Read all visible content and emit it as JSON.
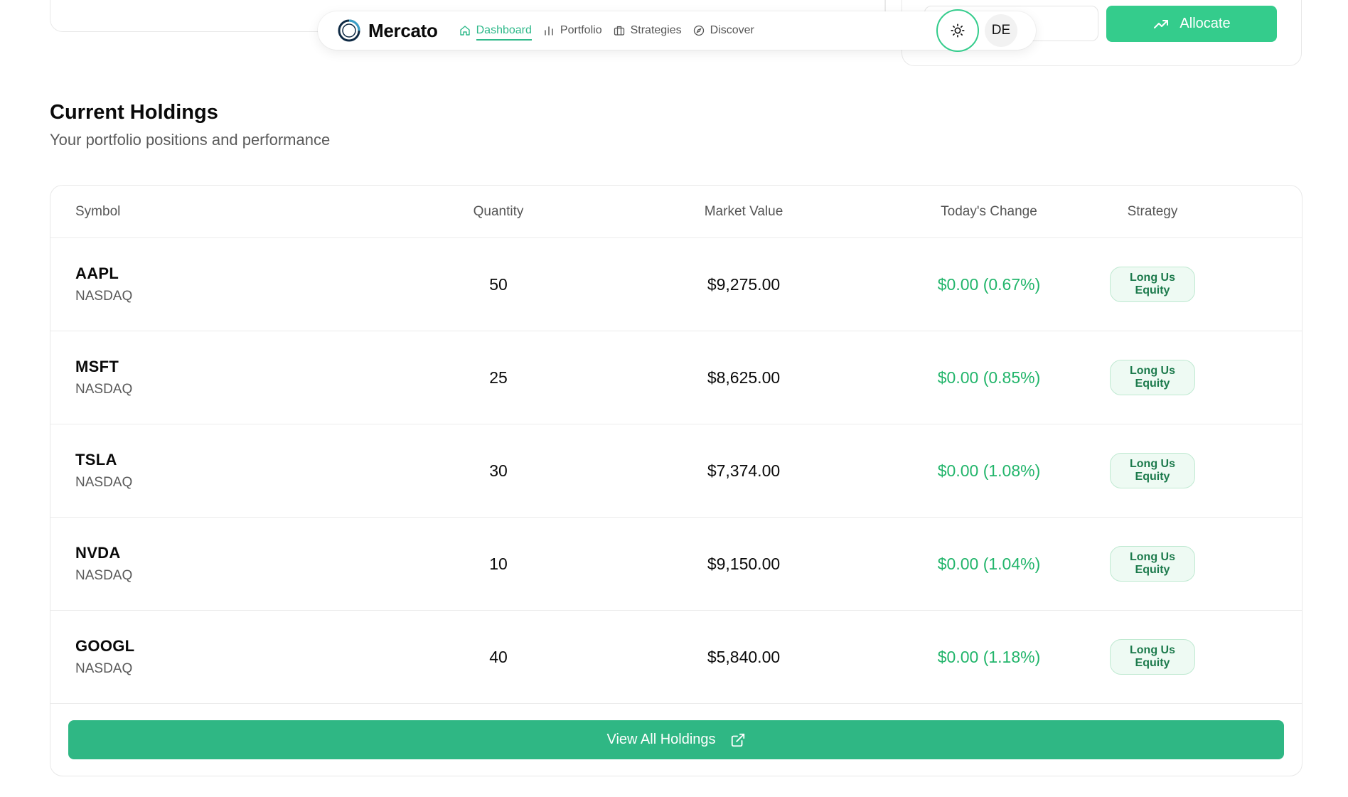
{
  "colors": {
    "accent": "#34cc8c",
    "positive": "#22b56b",
    "badge_bg": "#eefaf3",
    "badge_text": "#1c7a4c"
  },
  "top_partial": {
    "input_fragment": "'l",
    "allocate_label": "Allocate",
    "allocate_icon": "trending-up-icon"
  },
  "navbar": {
    "brand": "Mercato",
    "links": [
      {
        "label": "Dashboard",
        "icon": "home-icon",
        "active": true
      },
      {
        "label": "Portfolio",
        "icon": "bar-chart-icon",
        "active": false
      },
      {
        "label": "Strategies",
        "icon": "briefcase-icon",
        "active": false
      },
      {
        "label": "Discover",
        "icon": "compass-icon",
        "active": false
      }
    ],
    "theme_icon": "sun-icon",
    "avatar_initials": "DE"
  },
  "holdings": {
    "title": "Current Holdings",
    "subtitle": "Your portfolio positions and performance",
    "columns": [
      "Symbol",
      "Quantity",
      "Market Value",
      "Today's Change",
      "Strategy"
    ],
    "rows": [
      {
        "ticker": "AAPL",
        "exchange": "NASDAQ",
        "quantity": "50",
        "market_value": "$9,275.00",
        "change": "$0.00 (0.67%)",
        "strategy": "Long Us Equity"
      },
      {
        "ticker": "MSFT",
        "exchange": "NASDAQ",
        "quantity": "25",
        "market_value": "$8,625.00",
        "change": "$0.00 (0.85%)",
        "strategy": "Long Us Equity"
      },
      {
        "ticker": "TSLA",
        "exchange": "NASDAQ",
        "quantity": "30",
        "market_value": "$7,374.00",
        "change": "$0.00 (1.08%)",
        "strategy": "Long Us Equity"
      },
      {
        "ticker": "NVDA",
        "exchange": "NASDAQ",
        "quantity": "10",
        "market_value": "$9,150.00",
        "change": "$0.00 (1.04%)",
        "strategy": "Long Us Equity"
      },
      {
        "ticker": "GOOGL",
        "exchange": "NASDAQ",
        "quantity": "40",
        "market_value": "$5,840.00",
        "change": "$0.00 (1.18%)",
        "strategy": "Long Us Equity"
      }
    ],
    "view_all_label": "View All Holdings",
    "view_all_icon": "external-link-icon"
  }
}
